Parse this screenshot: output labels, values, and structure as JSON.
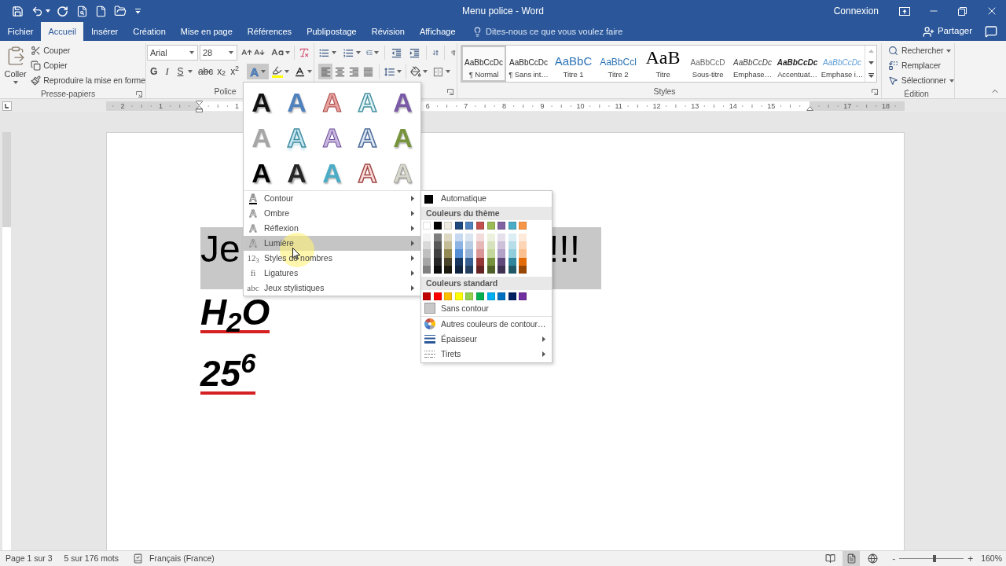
{
  "title_bar": {
    "title": "Menu police - Word",
    "account": "Connexion"
  },
  "tabs": [
    {
      "label": "Fichier",
      "selected": false
    },
    {
      "label": "Accueil",
      "selected": true
    },
    {
      "label": "Insérer",
      "selected": false
    },
    {
      "label": "Création",
      "selected": false
    },
    {
      "label": "Mise en page",
      "selected": false
    },
    {
      "label": "Références",
      "selected": false
    },
    {
      "label": "Publipostage",
      "selected": false
    },
    {
      "label": "Révision",
      "selected": false
    },
    {
      "label": "Affichage",
      "selected": false
    }
  ],
  "tell_me": {
    "placeholder": "Dites-nous ce que vous voulez faire"
  },
  "share": {
    "label": "Partager"
  },
  "ribbon": {
    "clipboard": {
      "paste": "Coller",
      "actions": [
        {
          "kind": "cut",
          "label": "Couper"
        },
        {
          "kind": "copy",
          "label": "Copier"
        },
        {
          "kind": "format-painter",
          "label": "Reproduire la mise en forme"
        }
      ],
      "label": "Presse-papiers"
    },
    "font": {
      "font_name": "Arial",
      "font_size": "28",
      "format_buttons": [
        {
          "kind": "bold",
          "label": "G",
          "has_menu": false
        },
        {
          "kind": "italic",
          "label": "I",
          "has_menu": false
        },
        {
          "kind": "underline",
          "label": "S",
          "has_menu": true
        },
        {
          "kind": "strike",
          "label": "abc",
          "has_menu": false
        },
        {
          "kind": "subscript",
          "label": "x$_{2}$",
          "has_menu": false
        },
        {
          "kind": "superscript",
          "label": "x$^{2}$",
          "has_menu": false
        }
      ],
      "text_effects": {
        "label": "A",
        "expanded": true
      },
      "label": "Police"
    },
    "paragraph": {
      "alignments": [
        {
          "kind": "left",
          "selected": true
        },
        {
          "kind": "center",
          "selected": false
        },
        {
          "kind": "right",
          "selected": false
        },
        {
          "kind": "justify",
          "selected": false
        }
      ]
    },
    "styles": {
      "items": [
        {
          "kind": "normal",
          "preview": "AaBbCcDc",
          "name": "¶ Normal",
          "selected": true
        },
        {
          "kind": "no-spacing",
          "preview": "AaBbCcDc",
          "name": "¶ Sans int…",
          "selected": false
        },
        {
          "kind": "heading-1",
          "preview": "AaBbC",
          "name": "Titre 1",
          "selected": false
        },
        {
          "kind": "heading-2",
          "preview": "AaBbCcl",
          "name": "Titre 2",
          "selected": false
        },
        {
          "kind": "title",
          "preview": "AaB",
          "name": "Titre",
          "selected": false
        },
        {
          "kind": "subtitle",
          "preview": "AaBbCcD",
          "name": "Sous-titre",
          "selected": false
        },
        {
          "kind": "subtle-emphasis",
          "preview": "AaBbCcDc",
          "name": "Emphase…",
          "selected": false
        },
        {
          "kind": "emphasis",
          "preview": "AaBbCcDc",
          "name": "Accentuat…",
          "selected": false
        },
        {
          "kind": "intense-emphasis",
          "preview": "AaBbCcDc",
          "name": "Emphase i…",
          "selected": false
        }
      ],
      "label": "Styles"
    },
    "editing": {
      "items": [
        {
          "kind": "find",
          "label": "Rechercher",
          "has_menu": true
        },
        {
          "kind": "replace",
          "label": "Remplacer",
          "has_menu": false
        },
        {
          "kind": "select",
          "label": "Sélectionner",
          "has_menu": true
        }
      ],
      "label": "Édition"
    }
  },
  "ruler": {
    "labels": [
      "2",
      "1",
      "1",
      "6",
      "7",
      "8",
      "9",
      "10",
      "11",
      "12",
      "13",
      "14",
      "15",
      "17",
      "18"
    ]
  },
  "document": {
    "highlighted_line": [
      "Je",
      "!!!"
    ],
    "lines": [
      {
        "text": "H$_{2}$O",
        "underlined": true
      },
      {
        "text": "25$^{6}$",
        "underlined": true
      }
    ]
  },
  "text_effects_menu": {
    "gallery": [
      {
        "label": "A",
        "kind": "shadow",
        "color": "#111111"
      },
      {
        "label": "A",
        "kind": "gradient",
        "color": "#4f81bd"
      },
      {
        "label": "A",
        "kind": "outlined-fill",
        "color": "#e8a2a0"
      },
      {
        "label": "A",
        "kind": "outline",
        "color": "#dff2f6"
      },
      {
        "label": "A",
        "kind": "gradient",
        "color": "#7a5aa6"
      },
      {
        "label": "A",
        "kind": "solid",
        "color": "#a6a6a6"
      },
      {
        "label": "A",
        "kind": "reflection",
        "color": "#c5e7f0"
      },
      {
        "label": "A",
        "kind": "outlined-fill",
        "color": "#c9b8e0"
      },
      {
        "label": "A",
        "kind": "outline",
        "color": "#dde6f3"
      },
      {
        "label": "A",
        "kind": "gradient",
        "color": "#77933c"
      },
      {
        "label": "A",
        "kind": "shadow",
        "color": "#000000"
      },
      {
        "label": "A",
        "kind": "shadow",
        "color": "#262626"
      },
      {
        "label": "A",
        "kind": "gradient",
        "color": "#4bacc6"
      },
      {
        "label": "A",
        "kind": "outline",
        "color": "#f6dcdb"
      },
      {
        "label": "A",
        "kind": "bevel",
        "color": "#d6d6cc"
      }
    ],
    "items": [
      {
        "kind": "contour",
        "symbol": "A",
        "label": "Contour",
        "selected": false
      },
      {
        "kind": "letter",
        "symbol": "A",
        "label": "Ombre",
        "selected": false
      },
      {
        "kind": "letter",
        "symbol": "A",
        "label": "Réflexion",
        "selected": false
      },
      {
        "kind": "letter",
        "symbol": "A",
        "label": "Lumière",
        "selected": true
      },
      {
        "kind": "text",
        "symbol": "12$_{3}$",
        "label": "Styles de nombres",
        "selected": false
      },
      {
        "kind": "text",
        "symbol": "fi",
        "label": "Ligatures",
        "selected": false
      },
      {
        "kind": "text",
        "symbol": "abc",
        "label": "Jeux stylistiques",
        "selected": false
      }
    ]
  },
  "outline_color_menu": {
    "automatic": {
      "label": "Automatique",
      "color": "#000000"
    },
    "theme_header": "Couleurs du thème",
    "theme_colors": [
      {
        "color": "#ffffff",
        "shades": [
          {
            "color": "#f2f2f2"
          },
          {
            "color": "#d9d9d9"
          },
          {
            "color": "#bfbfbf"
          },
          {
            "color": "#a6a6a6"
          },
          {
            "color": "#808080"
          }
        ]
      },
      {
        "color": "#000000",
        "shades": [
          {
            "color": "#7f7f7f"
          },
          {
            "color": "#595959"
          },
          {
            "color": "#404040"
          },
          {
            "color": "#262626"
          },
          {
            "color": "#0d0d0d"
          }
        ]
      },
      {
        "color": "#eeece1",
        "shades": [
          {
            "color": "#ddd9c3"
          },
          {
            "color": "#c4bd97"
          },
          {
            "color": "#948a54"
          },
          {
            "color": "#4a452a"
          },
          {
            "color": "#1e1c11"
          }
        ]
      },
      {
        "color": "#1f497d",
        "shades": [
          {
            "color": "#c6d9f0"
          },
          {
            "color": "#8db3e2"
          },
          {
            "color": "#548dd4"
          },
          {
            "color": "#17365d"
          },
          {
            "color": "#0f243e"
          }
        ]
      },
      {
        "color": "#4f81bd",
        "shades": [
          {
            "color": "#dbe5f1"
          },
          {
            "color": "#b8cce4"
          },
          {
            "color": "#95b3d7"
          },
          {
            "color": "#366092"
          },
          {
            "color": "#244061"
          }
        ]
      },
      {
        "color": "#c0504d",
        "shades": [
          {
            "color": "#f2dcdb"
          },
          {
            "color": "#e5b9b7"
          },
          {
            "color": "#d99694"
          },
          {
            "color": "#953734"
          },
          {
            "color": "#632423"
          }
        ]
      },
      {
        "color": "#9bbb59",
        "shades": [
          {
            "color": "#ebf1dd"
          },
          {
            "color": "#d7e3bc"
          },
          {
            "color": "#c3d69b"
          },
          {
            "color": "#76923c"
          },
          {
            "color": "#4f6128"
          }
        ]
      },
      {
        "color": "#8064a2",
        "shades": [
          {
            "color": "#e5e0ec"
          },
          {
            "color": "#ccc1d9"
          },
          {
            "color": "#b2a2c7"
          },
          {
            "color": "#5f497a"
          },
          {
            "color": "#3f3151"
          }
        ]
      },
      {
        "color": "#4bacc6",
        "shades": [
          {
            "color": "#dbeef3"
          },
          {
            "color": "#b7dde8"
          },
          {
            "color": "#92cddc"
          },
          {
            "color": "#31859b"
          },
          {
            "color": "#205867"
          }
        ]
      },
      {
        "color": "#f79646",
        "shades": [
          {
            "color": "#fdeada"
          },
          {
            "color": "#fbd5b5"
          },
          {
            "color": "#fac08f"
          },
          {
            "color": "#e36c09"
          },
          {
            "color": "#974806"
          }
        ]
      }
    ],
    "standard_header": "Couleurs standard",
    "standard_colors": [
      {
        "color": "#c00000"
      },
      {
        "color": "#ff0000"
      },
      {
        "color": "#ffc000"
      },
      {
        "color": "#ffff00"
      },
      {
        "color": "#92d050"
      },
      {
        "color": "#00b050"
      },
      {
        "color": "#00b0f0"
      },
      {
        "color": "#0070c0"
      },
      {
        "color": "#002060"
      },
      {
        "color": "#7030a0"
      }
    ],
    "items": [
      {
        "kind": "no-color",
        "label": "Sans contour",
        "has_submenu": false
      },
      {
        "kind": "more-colors",
        "label": "Autres couleurs de contour…",
        "has_submenu": false
      },
      {
        "kind": "weight",
        "label": "Épaisseur",
        "has_submenu": true
      },
      {
        "kind": "dashes",
        "label": "Tirets",
        "has_submenu": true
      }
    ]
  },
  "status_bar": {
    "page": "Page 1 sur 3",
    "words": "5 sur 176 mots",
    "language": "Français (France)",
    "views": [
      {
        "kind": "read",
        "selected": false
      },
      {
        "kind": "print",
        "selected": true
      },
      {
        "kind": "web",
        "selected": false
      }
    ],
    "zoom": {
      "minus": "-",
      "plus": "+",
      "level": 0.55,
      "reading": "160%"
    }
  }
}
